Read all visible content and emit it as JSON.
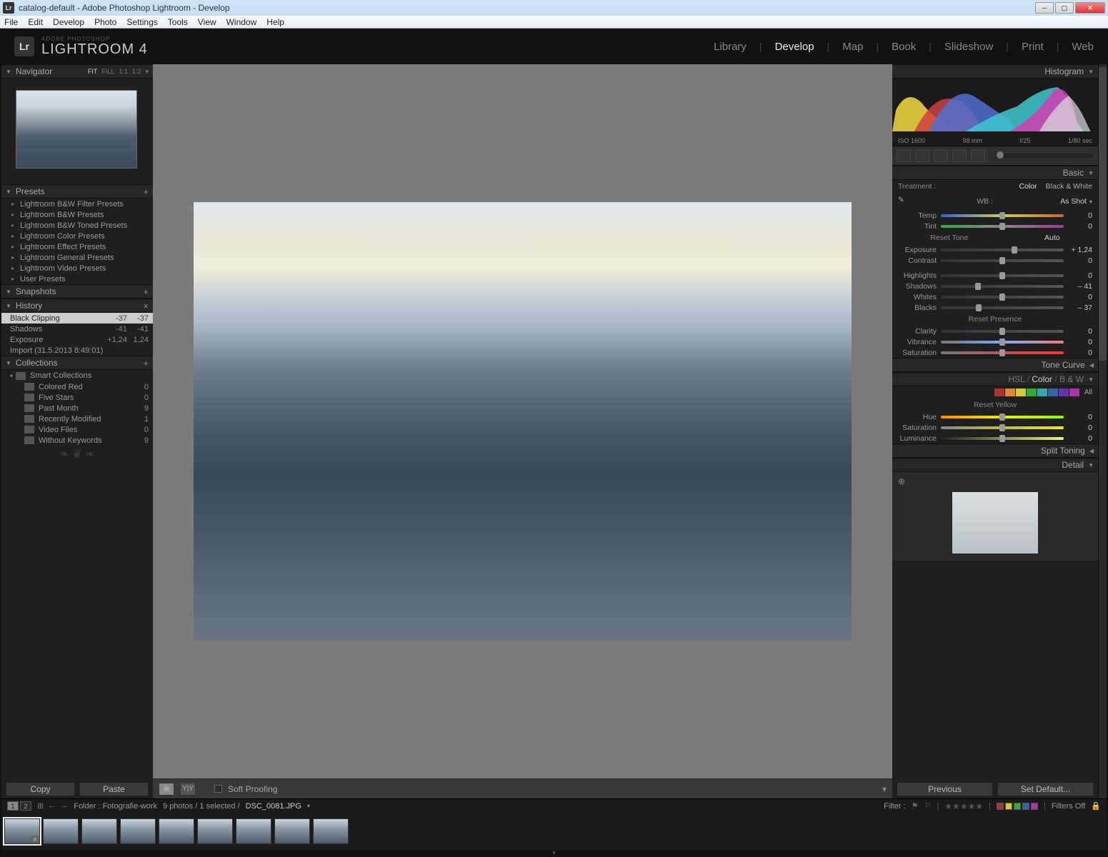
{
  "titlebar": {
    "text": "catalog-default - Adobe Photoshop Lightroom - Develop"
  },
  "menu": [
    "File",
    "Edit",
    "Develop",
    "Photo",
    "Settings",
    "Tools",
    "View",
    "Window",
    "Help"
  ],
  "identity": {
    "small": "ADOBE PHOTOSHOP",
    "big": "LIGHTROOM 4",
    "logo": "Lr"
  },
  "modules": [
    "Library",
    "Develop",
    "Map",
    "Book",
    "Slideshow",
    "Print",
    "Web"
  ],
  "activeModule": "Develop",
  "left": {
    "navigator": {
      "title": "Navigator",
      "modes": [
        "FIT",
        "FILL",
        "1:1",
        "1:2"
      ],
      "activeMode": "FIT"
    },
    "presets": {
      "title": "Presets",
      "items": [
        "Lightroom B&W Filter Presets",
        "Lightroom B&W Presets",
        "Lightroom B&W Toned Presets",
        "Lightroom Color Presets",
        "Lightroom Effect Presets",
        "Lightroom General Presets",
        "Lightroom Video Presets",
        "User Presets"
      ]
    },
    "snapshots": {
      "title": "Snapshots"
    },
    "history": {
      "title": "History",
      "items": [
        {
          "name": "Black Clipping",
          "v1": "-37",
          "v2": "-37",
          "sel": true
        },
        {
          "name": "Shadows",
          "v1": "-41",
          "v2": "-41"
        },
        {
          "name": "Exposure",
          "v1": "+1,24",
          "v2": "1,24"
        },
        {
          "name": "Import (31.5.2013 8:49:01)",
          "v1": "",
          "v2": ""
        }
      ]
    },
    "collections": {
      "title": "Collections",
      "smart": "Smart Collections",
      "items": [
        {
          "name": "Colored Red",
          "count": "0"
        },
        {
          "name": "Five Stars",
          "count": "0"
        },
        {
          "name": "Past Month",
          "count": "9"
        },
        {
          "name": "Recently Modified",
          "count": "1"
        },
        {
          "name": "Video Files",
          "count": "0"
        },
        {
          "name": "Without Keywords",
          "count": "9"
        }
      ]
    },
    "buttons": {
      "copy": "Copy",
      "paste": "Paste"
    }
  },
  "centerToolbar": {
    "softproof": "Soft Proofing"
  },
  "right": {
    "histogram": {
      "title": "Histogram",
      "iso": "ISO 1600",
      "lens": "98 mm",
      "aperture": "f/25",
      "shutter": "1/80 sec"
    },
    "basic": {
      "title": "Basic",
      "treatment": {
        "label": "Treatment :",
        "color": "Color",
        "bw": "Black & White"
      },
      "wb": {
        "label": "WB :",
        "value": "As Shot"
      },
      "temp": {
        "label": "Temp",
        "value": "0"
      },
      "tint": {
        "label": "Tint",
        "value": "0"
      },
      "resetTone": "Reset Tone",
      "auto": "Auto",
      "exposure": {
        "label": "Exposure",
        "value": "+ 1,24",
        "pos": 60
      },
      "contrast": {
        "label": "Contrast",
        "value": "0",
        "pos": 50
      },
      "highlights": {
        "label": "Highlights",
        "value": "0",
        "pos": 50
      },
      "shadows": {
        "label": "Shadows",
        "value": "– 41",
        "pos": 30
      },
      "whites": {
        "label": "Whites",
        "value": "0",
        "pos": 50
      },
      "blacks": {
        "label": "Blacks",
        "value": "– 37",
        "pos": 31
      },
      "resetPresence": "Reset Presence",
      "clarity": {
        "label": "Clarity",
        "value": "0",
        "pos": 50
      },
      "vibrance": {
        "label": "Vibrance",
        "value": "0",
        "pos": 50
      },
      "saturation": {
        "label": "Saturation",
        "value": "0",
        "pos": 50
      }
    },
    "tonecurve": {
      "title": "Tone Curve"
    },
    "hsl": {
      "title_hsl": "HSL",
      "title_color": "Color",
      "title_bw": "B & W",
      "colors": [
        "#a33",
        "#d83",
        "#cc3",
        "#3a3",
        "#3aa",
        "#36a",
        "#63a",
        "#a3a"
      ],
      "all": "All",
      "resetYellow": "Reset Yellow",
      "hue": {
        "label": "Hue",
        "value": "0"
      },
      "sat": {
        "label": "Saturation",
        "value": "0"
      },
      "lum": {
        "label": "Luminance",
        "value": "0"
      }
    },
    "splittoning": {
      "title": "Split Toning"
    },
    "detail": {
      "title": "Detail"
    },
    "buttons": {
      "prev": "Previous",
      "def": "Set Default..."
    }
  },
  "infobar": {
    "folder": "Folder : Fotografie-work",
    "count": "9 photos / 1 selected /",
    "file": "DSC_0081.JPG",
    "filter": "Filter :",
    "filtersOff": "Filters Off"
  },
  "thumbs": 9
}
